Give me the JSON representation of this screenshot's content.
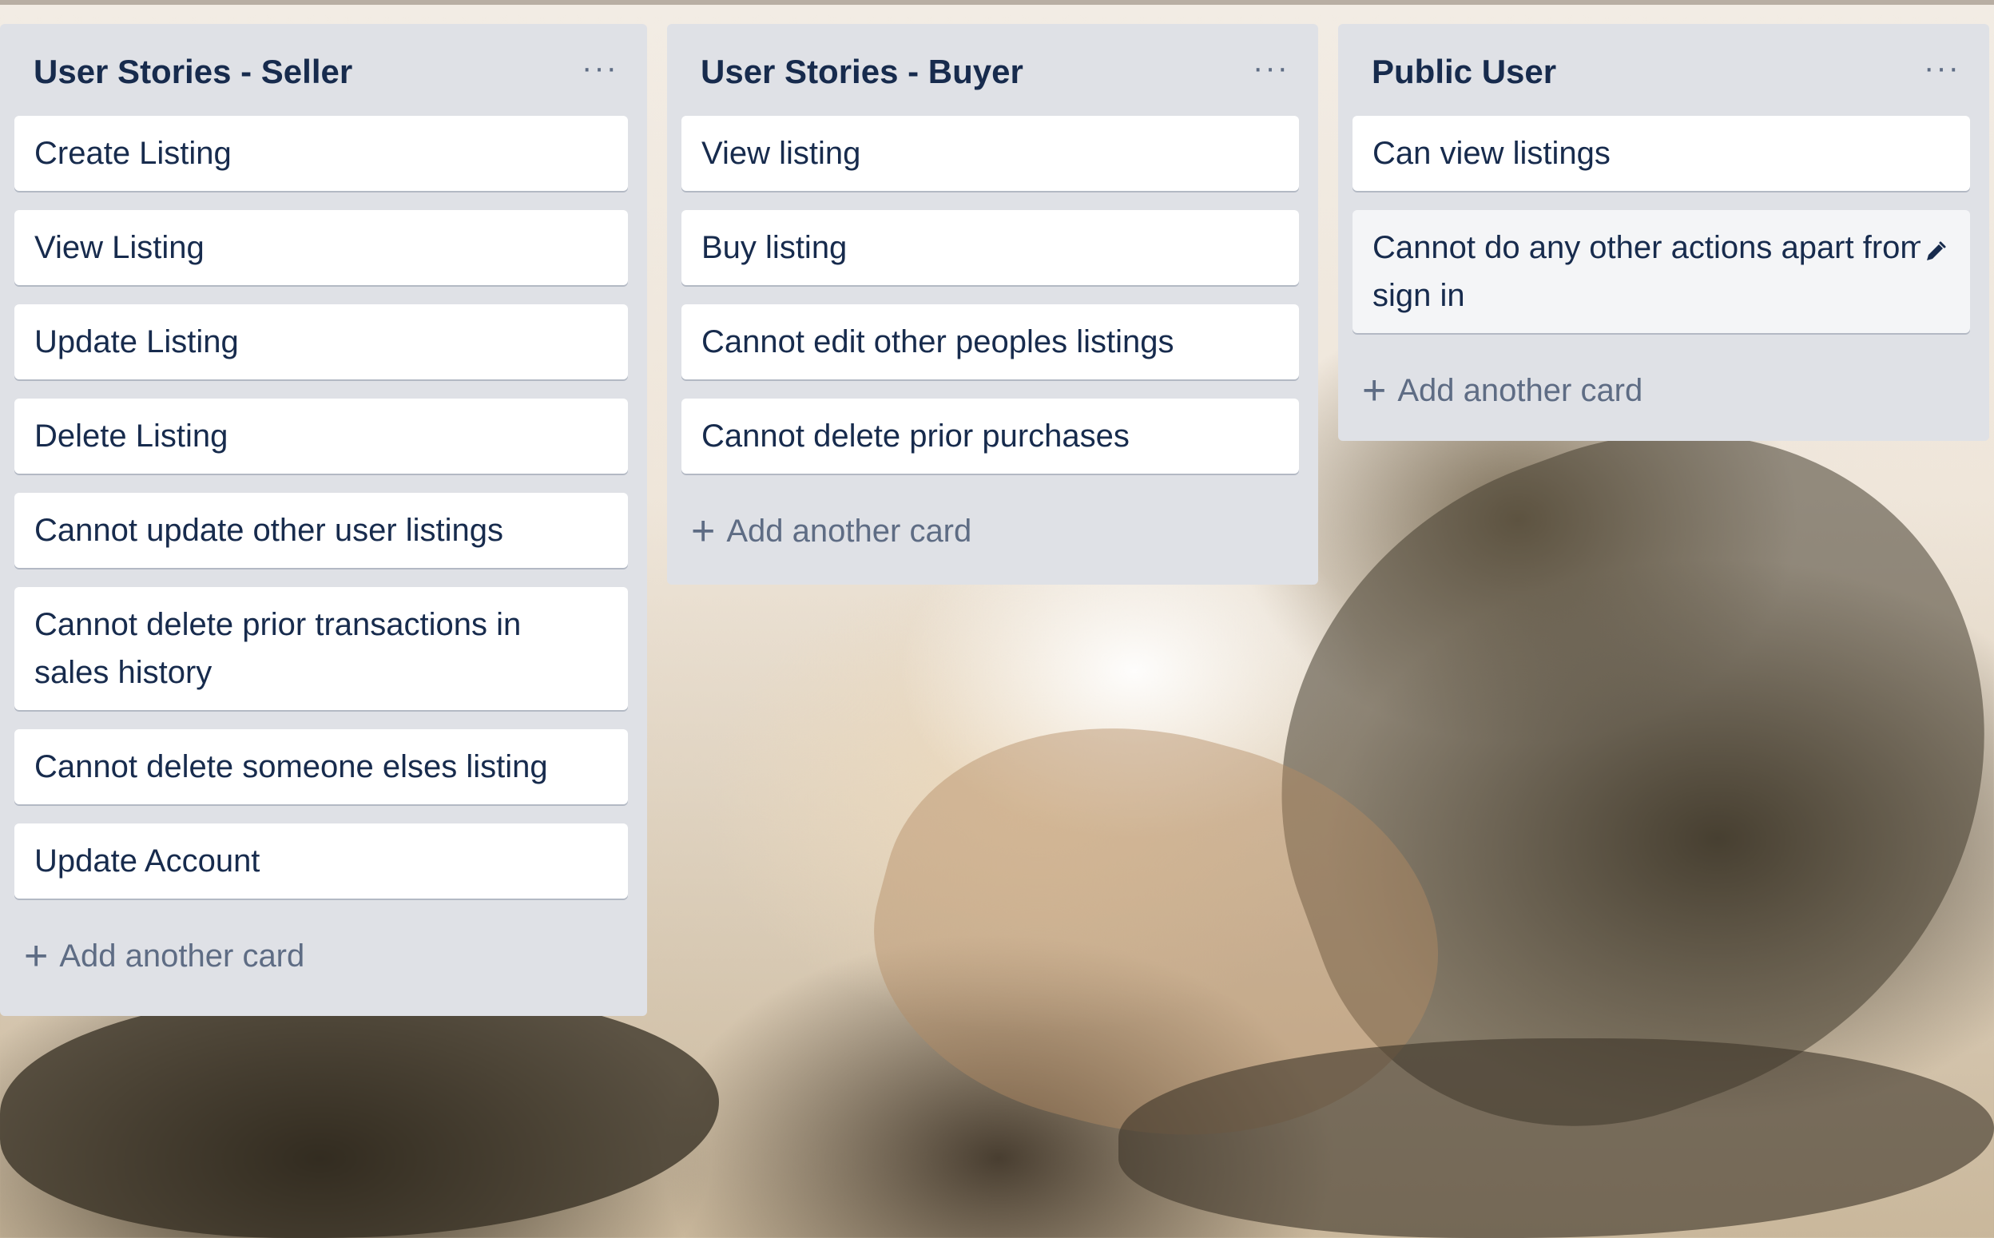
{
  "lists": {
    "seller": {
      "title": "User Stories - Seller",
      "menu": "···",
      "cards": [
        "Create Listing",
        "View Listing",
        "Update Listing",
        "Delete Listing",
        "Cannot update other user listings",
        "Cannot delete prior transactions in sales history",
        "Cannot delete someone elses listing",
        "Update Account"
      ],
      "add_card": "Add another card"
    },
    "buyer": {
      "title": "User Stories - Buyer",
      "menu": "···",
      "cards": [
        "View listing",
        "Buy listing",
        "Cannot edit other peoples listings",
        "Cannot delete prior purchases"
      ],
      "add_card": "Add another card"
    },
    "public": {
      "title": "Public User",
      "menu": "···",
      "cards": [
        "Can view listings",
        "Cannot do any other actions apart from sign in"
      ],
      "add_card": "Add another card"
    }
  },
  "icons": {
    "plus": "+",
    "edit": "pencil-icon",
    "menu": "more-icon"
  },
  "colors": {
    "list_bg": "#dfe1e6",
    "card_bg": "#ffffff",
    "title_text": "#172b4d",
    "muted_text": "#5e6c84"
  }
}
